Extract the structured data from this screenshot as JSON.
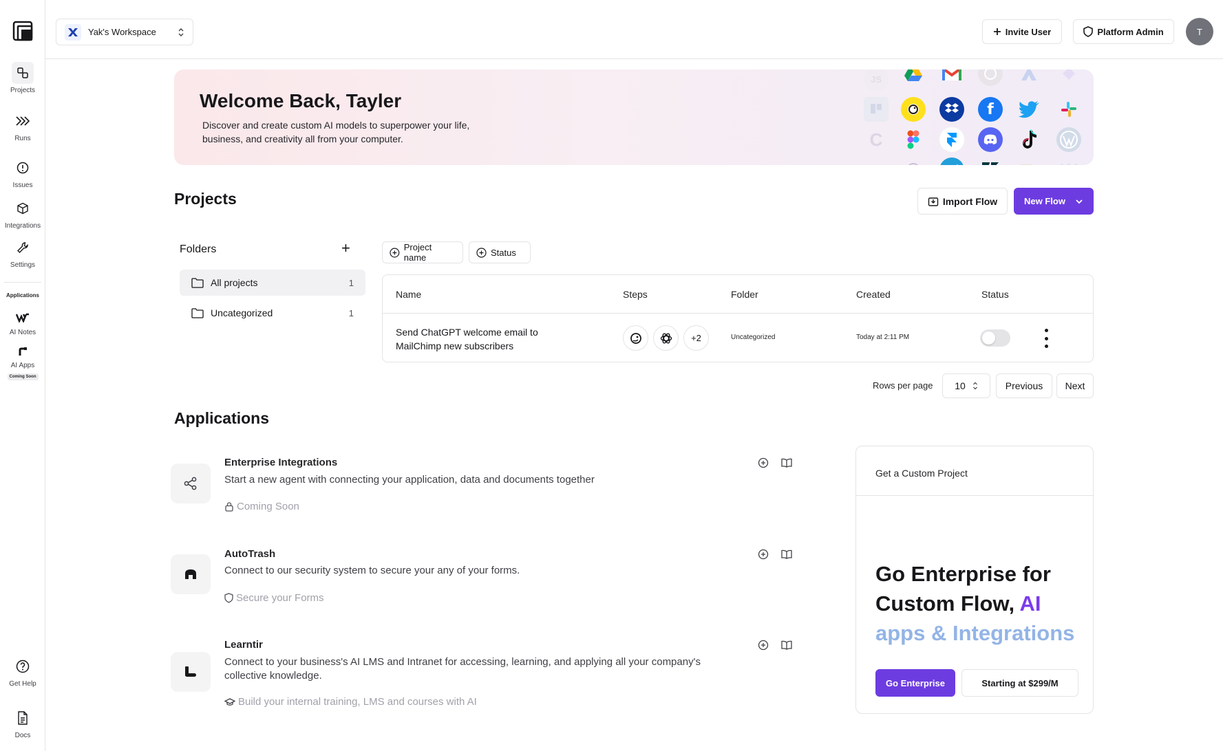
{
  "sidebar": {
    "nav": [
      {
        "label": "Projects",
        "icon": "projects-icon"
      },
      {
        "label": "Runs",
        "icon": "runs-icon"
      },
      {
        "label": "Issues",
        "icon": "issues-icon"
      },
      {
        "label": "Integrations",
        "icon": "box-icon"
      },
      {
        "label": "Settings",
        "icon": "wrench-icon"
      }
    ],
    "applications_label": "Applications",
    "apps": [
      {
        "label": "AI Notes"
      },
      {
        "label": "AI Apps",
        "badge": "Coming Soon"
      }
    ],
    "bottom": [
      {
        "label": "Get Help"
      },
      {
        "label": "Docs"
      }
    ]
  },
  "topbar": {
    "workspace": "Yak's Workspace",
    "invite_label": "Invite User",
    "admin_label": "Platform Admin",
    "avatar_initial": "T"
  },
  "banner": {
    "title": "Welcome Back, Tayler",
    "text": "Discover and create custom AI models to superpower your life, business, and creativity all from your computer."
  },
  "projects": {
    "title": "Projects",
    "import_label": "Import Flow",
    "new_flow_label": "New Flow",
    "folders_title": "Folders",
    "folders": [
      {
        "name": "All projects",
        "count": "1"
      },
      {
        "name": "Uncategorized",
        "count": "1"
      }
    ],
    "filters": [
      "Project name",
      "Status"
    ],
    "columns": [
      "Name",
      "Steps",
      "Folder",
      "Created",
      "Status"
    ],
    "rows": [
      {
        "name": "Send ChatGPT welcome email to MailChimp new subscribers",
        "steps_more": "+2",
        "folder": "Uncategorized",
        "created": "Today at 2:11 PM",
        "enabled": false
      }
    ],
    "rows_per_page_label": "Rows per page",
    "rows_per_page": "10",
    "previous_label": "Previous",
    "next_label": "Next"
  },
  "applications": {
    "title": "Applications",
    "items": [
      {
        "title": "Enterprise Integrations",
        "description": "Start a new agent with connecting your application, data and documents together",
        "meta": "Coming Soon",
        "icon": "share-icon"
      },
      {
        "title": "AutoTrash",
        "description": "Connect to our security system to secure your any of your forms.",
        "meta": "Secure your Forms",
        "icon": "autotrash-logo-icon"
      },
      {
        "title": "Learntir",
        "description": "Connect to your business's AI LMS and Intranet for accessing, learning, and applying all your company's collective knowledge.",
        "meta": "Build your internal training, LMS and courses with AI",
        "icon": "learntir-logo-icon"
      }
    ]
  },
  "promo": {
    "header": "Get a Custom Project",
    "headline_main": "Go Enterprise for Custom Flow, ",
    "headline_ai": "AI",
    "headline_rest": "apps & Integrations",
    "go_label": "Go Enterprise",
    "price_label": "Starting at $299/M"
  },
  "colors": {
    "accent": "#6d3ce0",
    "border": "#e4e4e7"
  }
}
